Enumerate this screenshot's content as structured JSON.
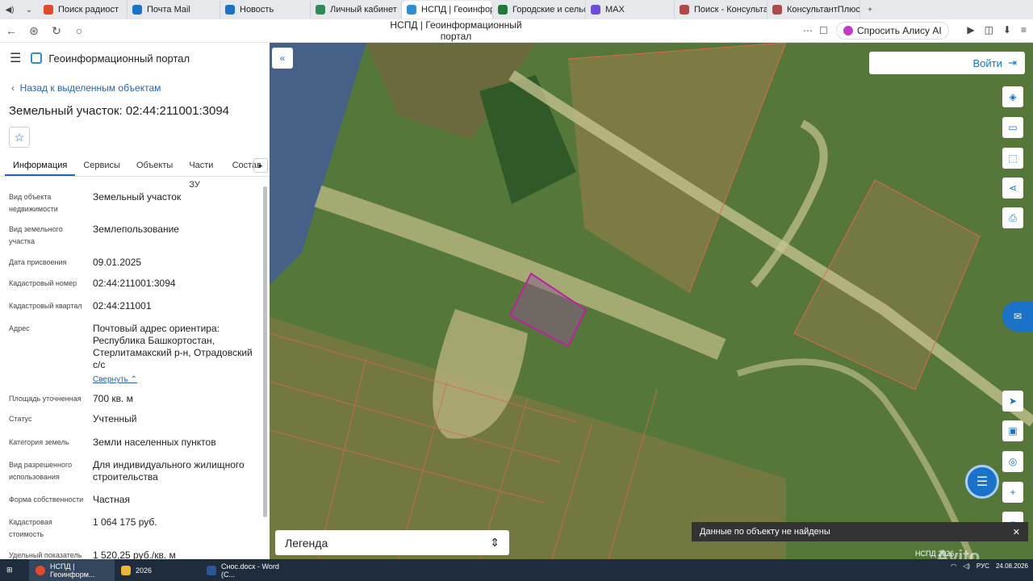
{
  "browser": {
    "tabs": [
      "Поиск радиост",
      "Почта Mail",
      "Новость",
      "Личный кабинет",
      "НСПД | Геоинфор",
      "Городские и сельск",
      "MAX",
      "Поиск - Консультант",
      "КонсультантПлюс Кр"
    ],
    "new_tab": "+",
    "page_title": "НСПД | Геоинформационный портал",
    "alisa": "Спросить Алису AI"
  },
  "panel": {
    "portal_title": "Геоинформационный портал",
    "back": "Назад к выделенным объектам",
    "object_title": "Земельный участок: 02:44:211001:3094",
    "tabs": [
      "Информация",
      "Сервисы",
      "Объекты",
      "Части ЗУ",
      "Состав"
    ],
    "props": [
      {
        "label": "Вид объекта недвижимости",
        "value": "Земельный участок"
      },
      {
        "label": "Вид земельного участка",
        "value": "Землепользование"
      },
      {
        "label": "Дата присвоения",
        "value": "09.01.2025"
      },
      {
        "label": "Кадастровый номер",
        "value": "02:44:211001:3094"
      },
      {
        "label": "Кадастровый квартал",
        "value": "02:44:211001"
      },
      {
        "label": "Адрес",
        "value": "Почтовый адрес ориентира: Республика Башкортостан, Стерлитамакский р-н, Отрадовский с/с",
        "link": "Свернуть"
      },
      {
        "label": "Площадь уточненная",
        "value": "700 кв. м"
      },
      {
        "label": "Статус",
        "value": "Учтенный"
      },
      {
        "label": "Категория земель",
        "value": "Земли населенных пунктов"
      },
      {
        "label": "Вид разрешенного использования",
        "value": "Для индивидуального жилищного строительства"
      },
      {
        "label": "Форма собственности",
        "value": "Частная"
      },
      {
        "label": "Кадастровая стоимость",
        "value": "1 064 175 руб."
      },
      {
        "label": "Удельный показатель",
        "value": "1 520,25 руб./кв. м"
      }
    ]
  },
  "map": {
    "login": "Войти",
    "legend": "Легенда",
    "toast": "Данные по объекту не найдены",
    "copyright": "НСПД 2026",
    "watermark": "Avito"
  },
  "taskbar": {
    "items": [
      "НСПД | Геоинформ...",
      "2026",
      "Снос.docx - Word (С..."
    ],
    "lang": "РУС",
    "date": "24.08.2026"
  }
}
